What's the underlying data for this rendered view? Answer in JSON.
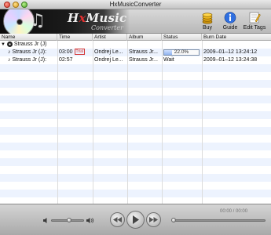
{
  "window": {
    "title": "HxMusicConverter"
  },
  "banner": {
    "brand_prefix": "H",
    "brand_x": "x",
    "brand_suffix": "Music",
    "subtitle": "Converter"
  },
  "toolbar": {
    "buttons": [
      {
        "label": "Buy",
        "icon": "coins-icon"
      },
      {
        "label": "Guide",
        "icon": "info-icon"
      },
      {
        "label": "Edit Tags",
        "icon": "edit-tags-icon"
      }
    ]
  },
  "table": {
    "columns": [
      "Name",
      "Time",
      "Artist",
      "Album",
      "Status",
      "Burn Date"
    ],
    "group": {
      "name": "Strauss Jr (J)"
    },
    "rows": [
      {
        "name": "Strauss Jr (J):",
        "time": "03:00",
        "trial": "Trial",
        "artist": "Ondrej Le...",
        "album": "Strauss Jr...",
        "status": "22.0%",
        "progress": 0.22,
        "burn_date": "2009–01–12 13:24:12"
      },
      {
        "name": "Strauss Jr (J):",
        "time": "02:57",
        "trial": "",
        "artist": "Ondrej Le...",
        "album": "Strauss Jr...",
        "status": "Wait",
        "progress": null,
        "burn_date": "2009–01–12 13:24:38"
      }
    ]
  },
  "player": {
    "time": "00:00 / 00:00",
    "volume_level": 0.55,
    "position_level": 0.0
  }
}
